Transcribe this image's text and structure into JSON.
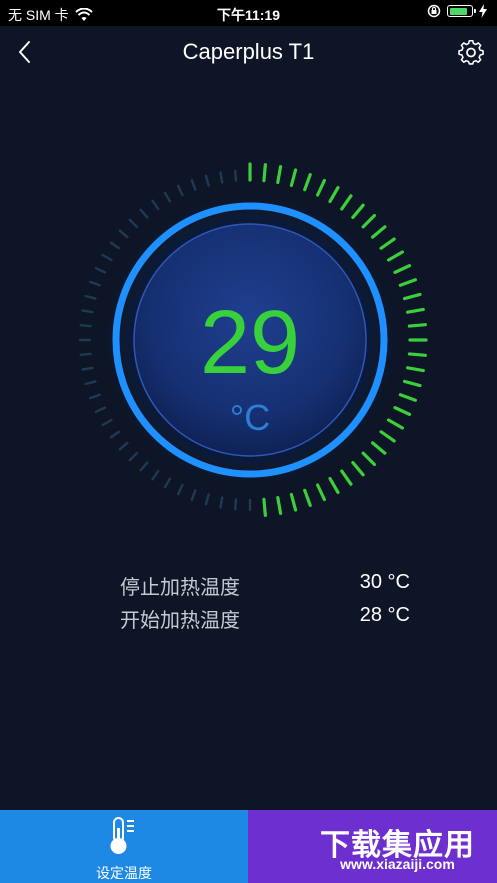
{
  "status_bar": {
    "carrier": "无 SIM 卡",
    "time": "下午11:19",
    "battery_level": 0.85
  },
  "nav": {
    "title": "Caperplus T1",
    "back_icon": "chevron-left-icon",
    "settings_icon": "gear-icon"
  },
  "gauge": {
    "temperature": "29",
    "unit": "°C",
    "colors": {
      "value": "#38d13c",
      "ring": "#1e90ff",
      "active_ticks": "#3ccf3c",
      "inactive_ticks": "#1e3a55"
    }
  },
  "info": {
    "stop_label": "停止加热温度",
    "stop_value": "30 °C",
    "start_label": "开始加热温度",
    "start_value": "28 °C"
  },
  "tab_bar": {
    "set_temp_label": "设定温度",
    "set_temp_icon": "thermometer-icon"
  },
  "watermark": {
    "main": "下载集应用",
    "sub": "www.xiazaiji.com"
  }
}
